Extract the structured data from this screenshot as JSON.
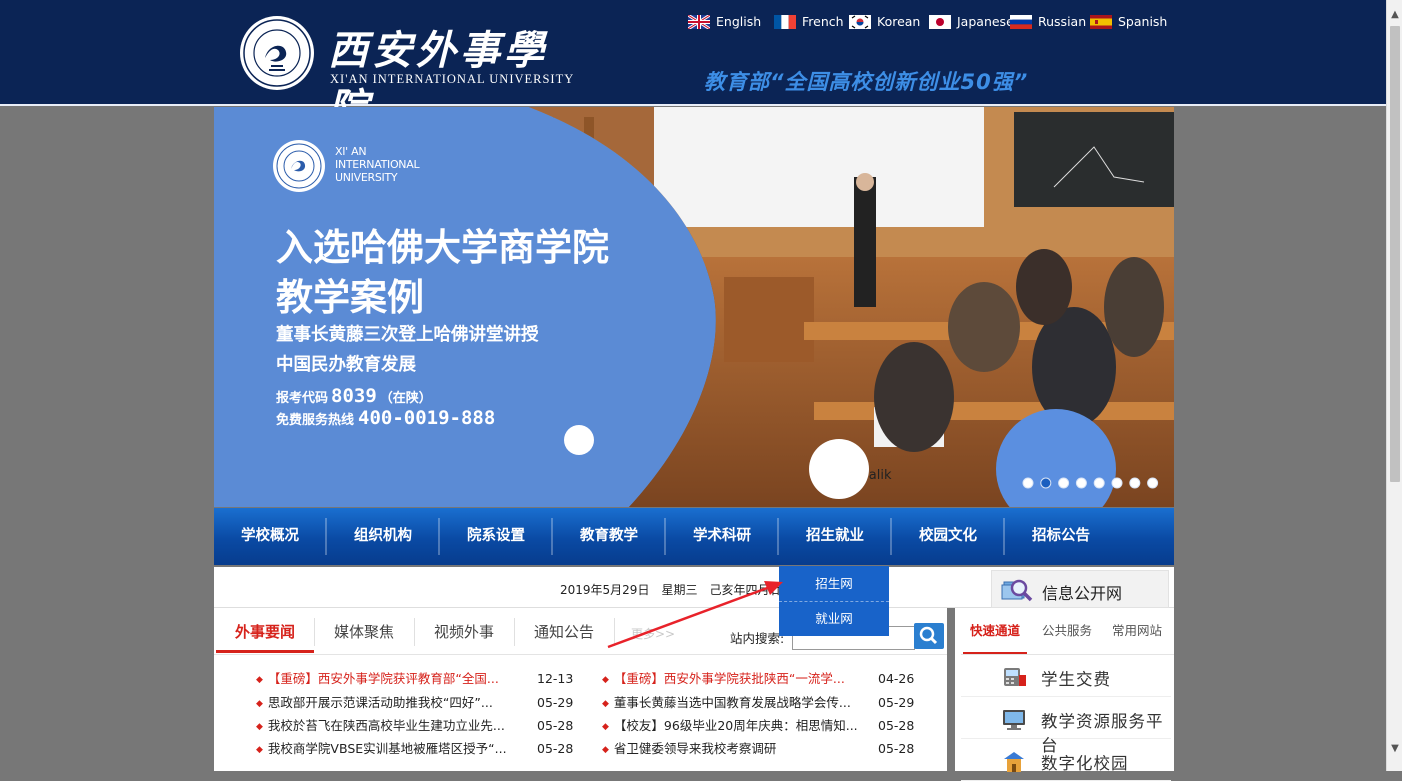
{
  "header": {
    "logo_cn": "西安外事學院",
    "logo_en": "XI'AN INTERNATIONAL UNIVERSITY",
    "slogan": "教育部“全国高校创新创业50强”",
    "languages": [
      {
        "label": "English",
        "icon": "uk-flag-icon"
      },
      {
        "label": "French",
        "icon": "france-flag-icon"
      },
      {
        "label": "Korean",
        "icon": "korea-flag-icon"
      },
      {
        "label": "Japanese",
        "icon": "japan-flag-icon"
      },
      {
        "label": "Russian",
        "icon": "russia-flag-icon"
      },
      {
        "label": "Spanish",
        "icon": "spain-flag-icon"
      }
    ]
  },
  "banner": {
    "uni_name": "XI' AN\nINTERNATIONAL\nUNIVERSITY",
    "headline_1": "入选哈佛大学商学院",
    "headline_2": "教学案例",
    "sub_1": "董事长黄藤三次登上哈佛讲堂讲授",
    "sub_2": "中国民办教育发展",
    "code_label": "报考代码",
    "code_value": "8039",
    "code_note": "（在陕）",
    "hotline_label": "免费服务热线",
    "hotline_value": "400-0019-888",
    "slide_count": 8,
    "active_slide": 2,
    "photo_text": "s Kralik"
  },
  "nav": {
    "items": [
      "学校概况",
      "组织机构",
      "院系设置",
      "教育教学",
      "学术科研",
      "招生就业",
      "校园文化",
      "招标公告"
    ]
  },
  "dropdown": {
    "items": [
      "招生网",
      "就业网"
    ]
  },
  "date_bar": {
    "date": "2019年5月29日　星期三　己亥年四月廿五",
    "info_label": "信息公开网"
  },
  "news": {
    "tabs": [
      "外事要闻",
      "媒体聚焦",
      "视频外事",
      "通知公告"
    ],
    "more": "更多>>",
    "search_label": "站内搜索:",
    "search_value": "",
    "left": [
      {
        "title": "【重磅】西安外事学院获评教育部“全国...",
        "date": "12-13",
        "highlight": true
      },
      {
        "title": "思政部开展示范课活动助推我校“四好”...",
        "date": "05-29",
        "highlight": false
      },
      {
        "title": "我校於苔飞在陕西高校毕业生建功立业先...",
        "date": "05-28",
        "highlight": false
      },
      {
        "title": "我校商学院VBSE实训基地被雁塔区授予“...",
        "date": "05-28",
        "highlight": false
      }
    ],
    "right": [
      {
        "title": "【重磅】西安外事学院获批陕西“一流学...",
        "date": "04-26",
        "highlight": true
      },
      {
        "title": "董事长黄藤当选中国教育发展战略学会传...",
        "date": "05-29",
        "highlight": false
      },
      {
        "title": "【校友】96级毕业20周年庆典：相思情知...",
        "date": "05-28",
        "highlight": false
      },
      {
        "title": "省卫健委领导来我校考察调研",
        "date": "05-28",
        "highlight": false
      }
    ]
  },
  "side": {
    "tabs": [
      "快速通道",
      "公共服务",
      "常用网站"
    ],
    "items": [
      {
        "label": "学生交费",
        "icon": "payment-terminal-icon"
      },
      {
        "label": "教学资源服务平台",
        "icon": "monitor-icon"
      },
      {
        "label": "数字化校园",
        "icon": "campus-icon"
      }
    ]
  }
}
